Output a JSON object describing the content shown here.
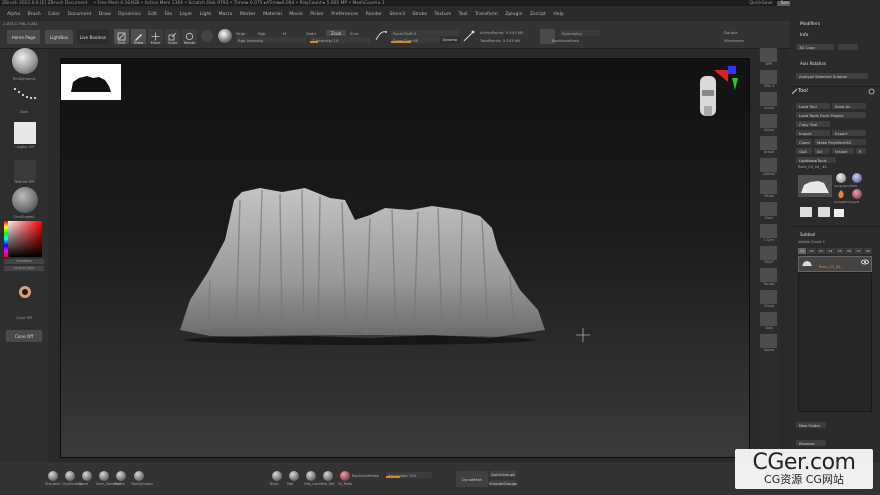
{
  "titlebar": {
    "app": "ZBrush 2022.0.6 [E]   ZBrush Document",
    "status": "• Free Mem 4.164GB • Active Mem 1364 • Scratch Disk 9793 • Timer▸ 0.075 ▸ATime▸0.004 • PolyCount ▸ 5.605 MP • MeshCount ▸ 1",
    "quicksave": "QuickSave",
    "seethrough": "See-through  0",
    "menus_btn": "Menus",
    "script": "DefaultZScript"
  },
  "menubar": {
    "items": [
      "Alpha",
      "Brush",
      "Color",
      "Document",
      "Draw",
      "Dynamics",
      "Edit",
      "File",
      "Layer",
      "Light",
      "Macro",
      "Marker",
      "Material",
      "Movie",
      "Picker",
      "Preferences",
      "Render",
      "Stencil",
      "Stroke",
      "Texture",
      "Tool",
      "Transform",
      "Zplugin",
      "Zscript",
      "Help"
    ]
  },
  "coords": "-1.073,1.756,-0.281",
  "topshelf": {
    "home": "Home Page",
    "lightbox": "LightBox",
    "live_boolean": "Live Boolean",
    "edit": "Edit",
    "draw": "Draw",
    "move": "Move",
    "scale": "Scale",
    "rotate": "Rotate",
    "mrgb": "Mrgb",
    "rgb": "Rgb",
    "m": "M",
    "zadd": "Zadd",
    "zsub": "Zsub",
    "zcut": "Zcut",
    "rgb_intensity": "Rgb Intensity",
    "z_intensity": "Z Intensity 10",
    "focal_shift": "Focal Shift 0",
    "draw_size": "Draw Size 46",
    "dynamic": "Dynamic",
    "active_points": "ActivePoints: 5.543 Mil",
    "total_points": "TotalPoints: 5.543 Mil",
    "symmetry": "Symmetry",
    "backface": "BackfaceMask",
    "double": "Double",
    "wireframe": "Wireframe"
  },
  "leftpanel": {
    "brush": "TrimDynamic",
    "stroke": "Dots",
    "alpha": "~Alpha Off",
    "texture": "Texture Off",
    "material": "SkinShade4",
    "gradient": "Gradient",
    "switch_color": "SwitchColor",
    "alternate": "Alternate",
    "cone": "Cone Off",
    "cone_btn": "Cone Off"
  },
  "rightstrip": {
    "labels": [
      "BPR",
      "SPix 3",
      "Scroll",
      "Zoom",
      "Actual",
      "AAHalf",
      "Persp",
      "Floor",
      "L.Sym",
      "PolyF",
      "Transp",
      "Ghost",
      "Solo",
      "Xpose"
    ]
  },
  "rightpanel": {
    "modifiers": "Modifiers",
    "info": "Info",
    "copy_3d": "3D Copy",
    "axis_rotation": "Axis Rotation",
    "analyze": "Analyze Selected Subtool",
    "tool_title": "Tool",
    "load_tool": "Load Tool",
    "save_as": "Save As",
    "load_project": "Load Tools From Project",
    "copy_tool": "Copy Tool",
    "import": "Import",
    "export": "Export",
    "clone": "Clone",
    "make_polymesh": "Make PolyMesh3D",
    "goz": "GoZ",
    "all": "All",
    "visible": "Visible",
    "r": "R",
    "lightbox_tools": "Lightbox▸Tools",
    "current_tool": "Rock_03_04_  40",
    "tool_thumbs": [
      "Rock_03_04_",
      "SphereE Inflat8",
      "PolyMesh3D",
      "SimpleB Eraser8",
      "Cylinder3D",
      "Rock_03_04_"
    ],
    "subtool": "Subtool",
    "visible_count": "Visible Count 1",
    "subtool_item": "Rock_03_04_",
    "v_tabs": [
      "V1",
      "V2",
      "V3",
      "V4",
      "V5",
      "V6",
      "V7",
      "V8"
    ],
    "new_folder": "New Folder",
    "rename": "Rename"
  },
  "bottomshelf": {
    "brushes": [
      "Standard",
      "ClayBuildup",
      "Move",
      "Dam_Standard",
      "hPolish",
      "TrimDynamic"
    ],
    "brushes2": [
      "Basic",
      "Mat",
      "Orb_cracks",
      "Orb_flat",
      "Tri_Parts"
    ],
    "backface": "BackfaceMask",
    "resolution": "Resolution 304",
    "dynamesh": "DynaMesh",
    "quickgroups": "QuickGroups",
    "smooth_groups": "SmoothGroups",
    "zremesher": "ZRemesher"
  },
  "watermark": {
    "big": "CGer.com",
    "small": "CG资源 CG网站"
  }
}
